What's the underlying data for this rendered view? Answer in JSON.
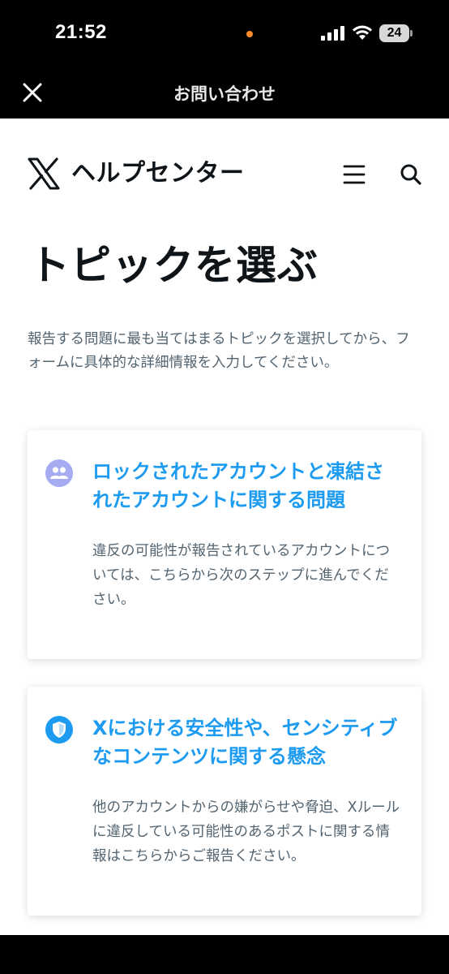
{
  "status_bar": {
    "time": "21:52",
    "battery_level": "24"
  },
  "nav_bar": {
    "title": "お問い合わせ",
    "close_icon": "close-icon"
  },
  "header": {
    "logo_icon": "x-logo",
    "site_title": "ヘルプセンター",
    "menu_icon": "hamburger-menu-icon",
    "search_icon": "search-icon"
  },
  "main": {
    "title": "トピックを選ぶ",
    "description": "報告する問題に最も当てはまるトピックを選択してから、フォームに具体的な詳細情報を入力してください。",
    "topics": [
      {
        "icon": "users-icon",
        "icon_color": "#a5acf2",
        "title": "ロックされたアカウントと凍結されたアカウントに関する問題",
        "text": "違反の可能性が報告されているアカウントについては、こちらから次のステップに進んでください。"
      },
      {
        "icon": "shield-icon",
        "icon_color": "#1d9bf0",
        "title": "Xにおける安全性や、センシティブなコンテンツに関する懸念",
        "text": "他のアカウントからの嫌がらせや脅迫、Xルールに違反している可能性のあるポストに関する情報はこちらからご報告ください。"
      }
    ]
  },
  "colors": {
    "accent": "#1d9bf0",
    "text_primary": "#0f1419",
    "text_secondary": "#536471"
  }
}
